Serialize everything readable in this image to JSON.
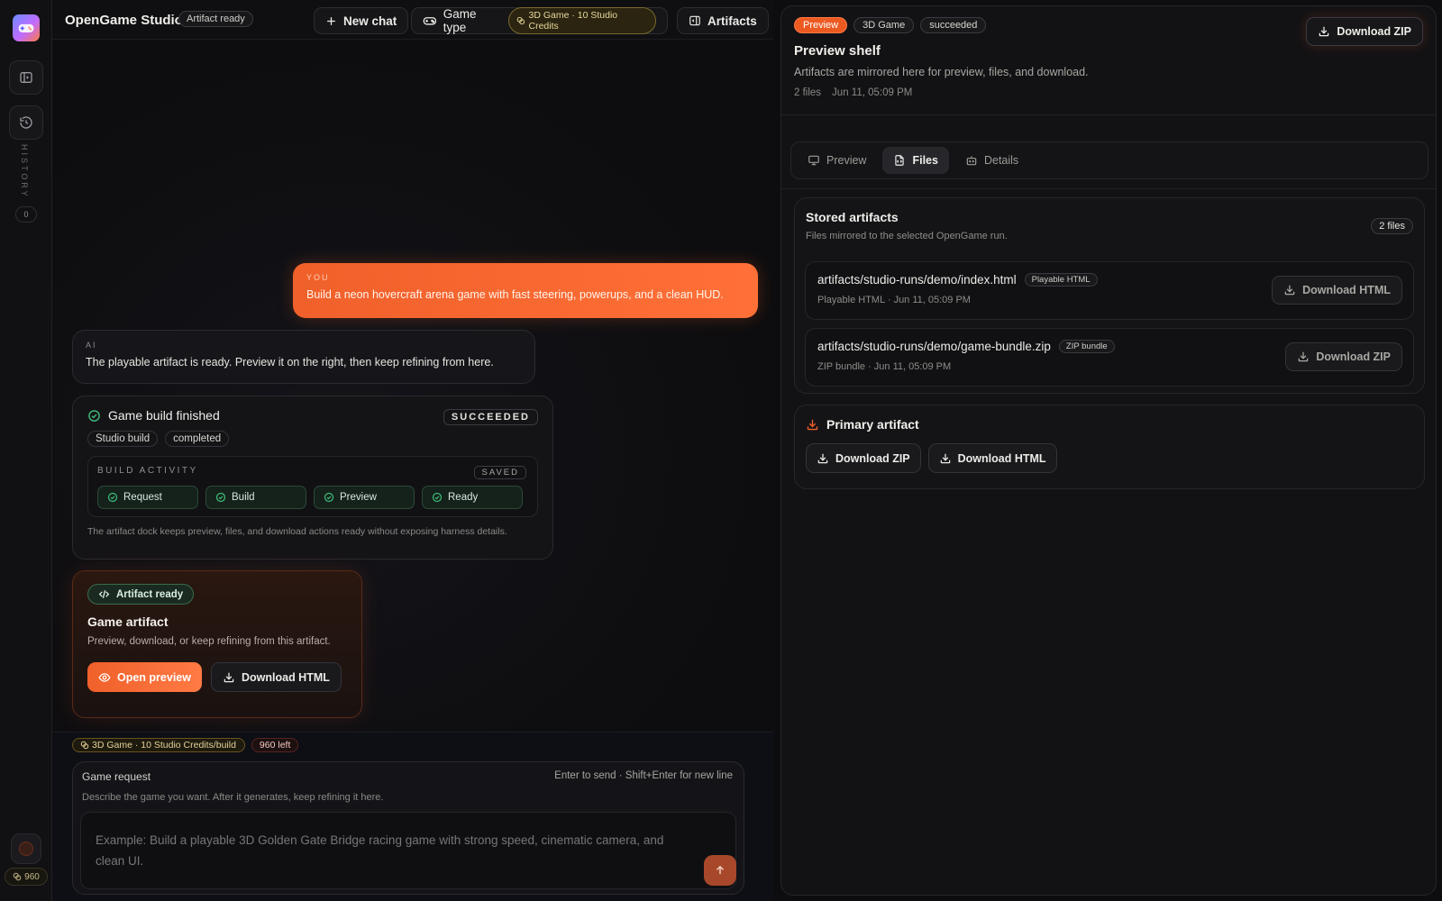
{
  "sidebar": {
    "history_label": "HISTORY",
    "history_count": "0",
    "credits": "960"
  },
  "header": {
    "app_title": "OpenGame Studio",
    "status_pill": "Artifact ready",
    "new_chat_label": "New chat",
    "game_type_label": "Game type",
    "game_type_chip": "3D Game · 10 Studio Credits",
    "artifacts_label": "Artifacts"
  },
  "chat": {
    "user": {
      "who": "YOU",
      "message": "Build a neon hovercraft arena game with fast steering, powerups, and a clean HUD."
    },
    "ai": {
      "who": "AI",
      "message": "The playable artifact is ready. Preview it on the right, then keep refining from here."
    },
    "build": {
      "title": "Game build finished",
      "status": "SUCCEEDED",
      "tags": [
        "Studio build",
        "completed"
      ],
      "activity_label": "BUILD ACTIVITY",
      "saved_label": "SAVED",
      "steps": [
        "Request",
        "Build",
        "Preview",
        "Ready"
      ],
      "footnote": "The artifact dock keeps preview, files, and download actions ready without exposing harness details."
    },
    "artifact": {
      "chip": "Artifact ready",
      "title": "Game artifact",
      "description": "Preview, download, or keep refining from this artifact.",
      "open_preview_label": "Open preview",
      "download_html_label": "Download HTML"
    }
  },
  "composer": {
    "credit_chip": "3D Game · 10 Studio Credits/build",
    "left_chip": "960 left",
    "label": "Game request",
    "hint": "Enter to send · Shift+Enter for new line",
    "sub": "Describe the game you want. After it generates, keep refining it here.",
    "placeholder": "Example: Build a playable 3D Golden Gate Bridge racing game with strong speed, cinematic camera, and clean UI."
  },
  "panel": {
    "badges": [
      "Preview",
      "3D Game",
      "succeeded"
    ],
    "title": "Preview shelf",
    "description": "Artifacts are mirrored here for preview, files, and download.",
    "file_count": "2 files",
    "timestamp": "Jun 11, 05:09 PM",
    "download_zip_label": "Download ZIP",
    "tabs": [
      {
        "label": "Preview",
        "icon": "monitor-icon"
      },
      {
        "label": "Files",
        "icon": "file-code-icon",
        "active": true
      },
      {
        "label": "Details",
        "icon": "bot-icon"
      }
    ],
    "stored": {
      "title": "Stored artifacts",
      "subtitle": "Files mirrored to the selected OpenGame run.",
      "count": "2 files",
      "files": [
        {
          "path": "artifacts/studio-runs/demo/index.html",
          "tag": "Playable HTML",
          "meta": "Playable HTML · Jun 11, 05:09 PM",
          "button": "Download HTML"
        },
        {
          "path": "artifacts/studio-runs/demo/game-bundle.zip",
          "tag": "ZIP bundle",
          "meta": "ZIP bundle · Jun 11, 05:09 PM",
          "button": "Download ZIP"
        }
      ]
    },
    "primary": {
      "title": "Primary artifact",
      "download_zip": "Download ZIP",
      "download_html": "Download HTML"
    }
  },
  "colors": {
    "accent": "#f0602a",
    "success": "#3fbf7a",
    "background": "#0d0d0f"
  }
}
